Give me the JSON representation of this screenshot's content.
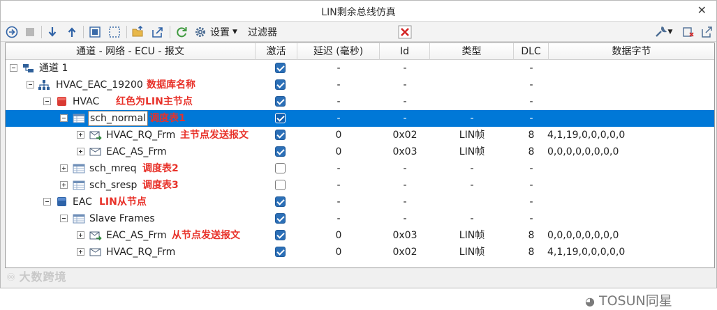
{
  "window": {
    "title": "LIN剩余总线仿真"
  },
  "toolbar": {
    "settings_label": "设置",
    "filter_label": "过滤器"
  },
  "columns": {
    "path": "通道 - 网络 - ECU - 报文",
    "active": "激活",
    "delay": "延迟 (毫秒)",
    "id": "Id",
    "type": "类型",
    "dlc": "DLC",
    "data": "数据字节"
  },
  "rows": [
    {
      "name": "通道 1",
      "annotation": "",
      "active": true,
      "delay": "-",
      "id": "-",
      "type": "",
      "dlc": "-",
      "data": ""
    },
    {
      "name": "HVAC_EAC_19200",
      "annotation": "数据库名称",
      "active": true,
      "delay": "-",
      "id": "-",
      "type": "",
      "dlc": "-",
      "data": ""
    },
    {
      "name": "HVAC",
      "annotation": "红色为LIN主节点",
      "active": true,
      "delay": "-",
      "id": "-",
      "type": "",
      "dlc": "-",
      "data": ""
    },
    {
      "name": "sch_normal",
      "annotation": "调度表1",
      "active": true,
      "delay": "-",
      "id": "-",
      "type": "-",
      "dlc": "-",
      "data": ""
    },
    {
      "name": "HVAC_RQ_Frm",
      "annotation": "主节点发送报文",
      "active": true,
      "delay": "0",
      "id": "0x02",
      "type": "LIN帧",
      "dlc": "8",
      "data": "4,1,19,0,0,0,0,0"
    },
    {
      "name": "EAC_AS_Frm",
      "annotation": "",
      "active": true,
      "delay": "0",
      "id": "0x03",
      "type": "LIN帧",
      "dlc": "8",
      "data": "0,0,0,0,0,0,0,0"
    },
    {
      "name": "sch_mreq",
      "annotation": "调度表2",
      "active": false,
      "delay": "-",
      "id": "-",
      "type": "-",
      "dlc": "-",
      "data": ""
    },
    {
      "name": "sch_sresp",
      "annotation": "调度表3",
      "active": false,
      "delay": "-",
      "id": "-",
      "type": "-",
      "dlc": "-",
      "data": ""
    },
    {
      "name": "EAC",
      "annotation": "LIN从节点",
      "active": true,
      "delay": "-",
      "id": "-",
      "type": "",
      "dlc": "-",
      "data": ""
    },
    {
      "name": "Slave Frames",
      "annotation": "",
      "active": true,
      "delay": "-",
      "id": "-",
      "type": "-",
      "dlc": "-",
      "data": ""
    },
    {
      "name": "EAC_AS_Frm",
      "annotation": "从节点发送报文",
      "active": true,
      "delay": "0",
      "id": "0x03",
      "type": "LIN帧",
      "dlc": "8",
      "data": "0,0,0,0,0,0,0,0"
    },
    {
      "name": "HVAC_RQ_Frm",
      "annotation": "",
      "active": true,
      "delay": "0",
      "id": "0x02",
      "type": "LIN帧",
      "dlc": "8",
      "data": "4,1,19,0,0,0,0,0"
    }
  ],
  "watermarks": {
    "left": "大数跨境",
    "right": "TOSUN同星"
  },
  "colors": {
    "selection": "#0078d7",
    "annotation": "#e8322a",
    "master_node": "#d93a33",
    "slave_node": "#2e63a8",
    "checkbox": "#2b6fb7"
  }
}
